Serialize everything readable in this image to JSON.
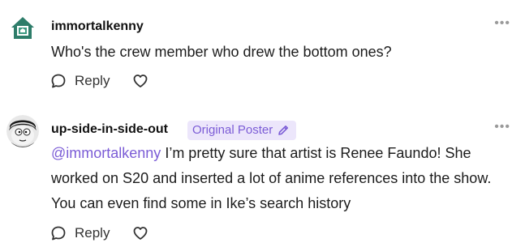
{
  "comments": [
    {
      "username": "immortalkenny",
      "text": "Who's the crew member who drew the bottom ones?",
      "more_label": "•••",
      "reply_label": "Reply"
    },
    {
      "username": "up-side-in-side-out",
      "badge": "Original Poster",
      "mention": "@immortalkenny",
      "text": " I’m pretty sure that artist is Renee Faundo! She worked on S20 and inserted a lot of anime references into the show. You can even find some in Ike’s search history",
      "more_label": "•••",
      "reply_label": "Reply"
    }
  ],
  "colors": {
    "accent": "#7b5cd6",
    "badge_bg": "#ece6fb",
    "avatar1_bg": "#2e7d6a"
  },
  "icons": [
    "house-avatar-icon",
    "pencil-icon",
    "speech-bubble-icon",
    "heart-icon",
    "more-dots-icon"
  ]
}
